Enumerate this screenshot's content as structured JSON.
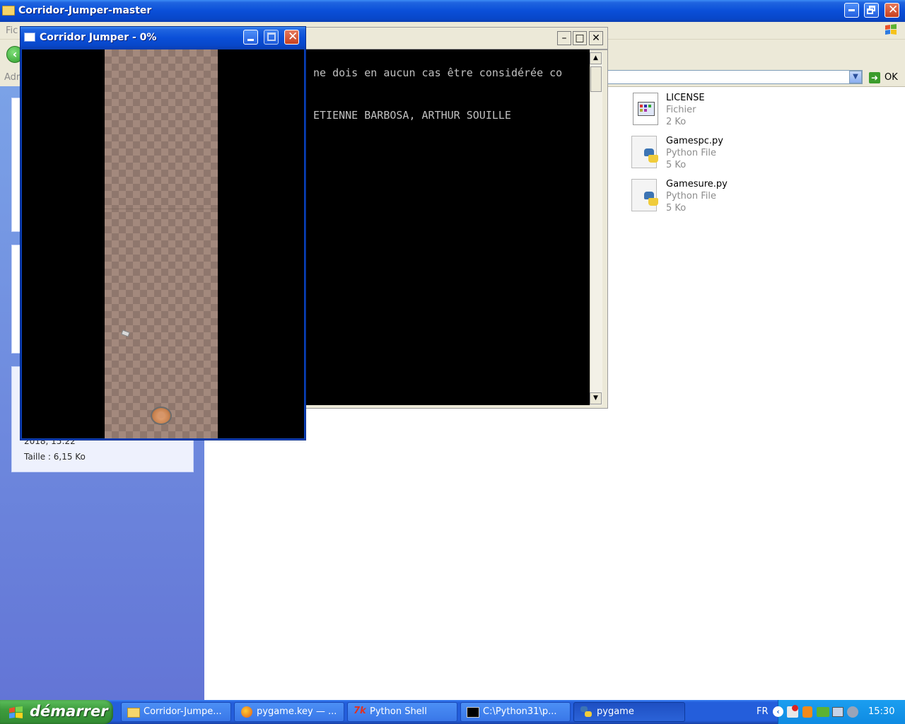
{
  "explorer": {
    "title": "Corridor-Jumper-master",
    "menu_partial": "Fic",
    "address_label_partial": "Adr",
    "go_label": "OK",
    "details": {
      "date_partial": "2018, 15:22",
      "size": "Taille : 6,15 Ko"
    },
    "files": [
      {
        "name": "LICENSE",
        "type": "Fichier",
        "size": "2 Ko",
        "icon": "document-icon"
      },
      {
        "name": "Gamespc.py",
        "type": "Python File",
        "size": "5 Ko",
        "icon": "python-file-icon"
      },
      {
        "name": "Gamesure.py",
        "type": "Python File",
        "size": "5 Ko",
        "icon": "python-file-icon"
      }
    ]
  },
  "console": {
    "lines": [
      "ne dois en aucun cas être considérée co",
      "ETIENNE BARBOSA, ARTHUR SOUILLE"
    ]
  },
  "game": {
    "title": "Corridor Jumper - 0%",
    "colors": {
      "corridor_light": "#a3897d",
      "corridor_dark": "#8f776d",
      "background": "#000000"
    }
  },
  "taskbar": {
    "start_label": "démarrer",
    "tasks": [
      {
        "label": "Corridor-Jumpe...",
        "icon": "folder-icon",
        "active": false
      },
      {
        "label": "pygame.key — ...",
        "icon": "firefox-icon",
        "active": false
      },
      {
        "label": "Python Shell",
        "icon": "idle-icon",
        "active": false
      },
      {
        "label": "C:\\Python31\\p...",
        "icon": "console-icon",
        "active": false
      },
      {
        "label": "pygame",
        "icon": "python-icon",
        "active": true
      }
    ],
    "tray": {
      "language": "FR",
      "time": "15:30"
    }
  }
}
